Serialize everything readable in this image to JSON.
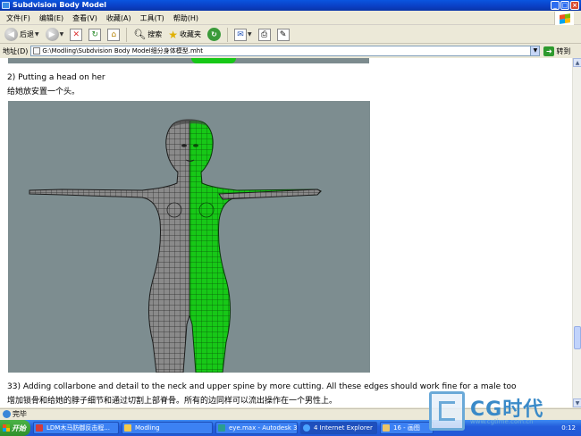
{
  "window": {
    "title": "Subdvision Body Model",
    "controls": [
      "_",
      "□",
      "×"
    ]
  },
  "menubar": {
    "items": [
      "文件(F)",
      "编辑(E)",
      "查看(V)",
      "收藏(A)",
      "工具(T)",
      "帮助(H)"
    ]
  },
  "toolbar": {
    "back_label": "后退",
    "search_label": "搜索",
    "favorites_label": "收藏夹"
  },
  "addressbar": {
    "label": "地址(D)",
    "value": "G:\\Modling\\Subdvision Body Model细分身体模型.mht",
    "go_label": "转到"
  },
  "content": {
    "heading_en": "2) Putting a head on her",
    "heading_zh": "给她放安置一个头。",
    "caption_en": "33) Adding collarbone and detail to the neck and upper spine by more cutting. All these edges should work fine for a male too",
    "caption_zh": "增加锁骨和给她的脖子细节和通过切割上部脊骨。所有的边同样可以流出操作在一个男性上。"
  },
  "statusbar": {
    "text": "完毕"
  },
  "taskbar": {
    "start_label": "开始",
    "tasks": [
      {
        "label": "LDM木马防御反击程...",
        "color": "#d23c3c"
      },
      {
        "label": "Modling",
        "color": "#f2c94c"
      },
      {
        "label": "eye.max - Autodesk 3...",
        "color": "#2a9d8f"
      },
      {
        "label": "4 Internet Explorer",
        "color": "#4aa3ff"
      },
      {
        "label": "16 - 画图",
        "color": "#e9c46a"
      }
    ],
    "clock": "0:12"
  },
  "watermark": {
    "brand": "CG时代",
    "url": "www.cgtime.com.cn"
  },
  "colors": {
    "titlebar": "#0a48d6",
    "mesh_green": "#17c817",
    "viewport_bg": "#7d8d90"
  }
}
